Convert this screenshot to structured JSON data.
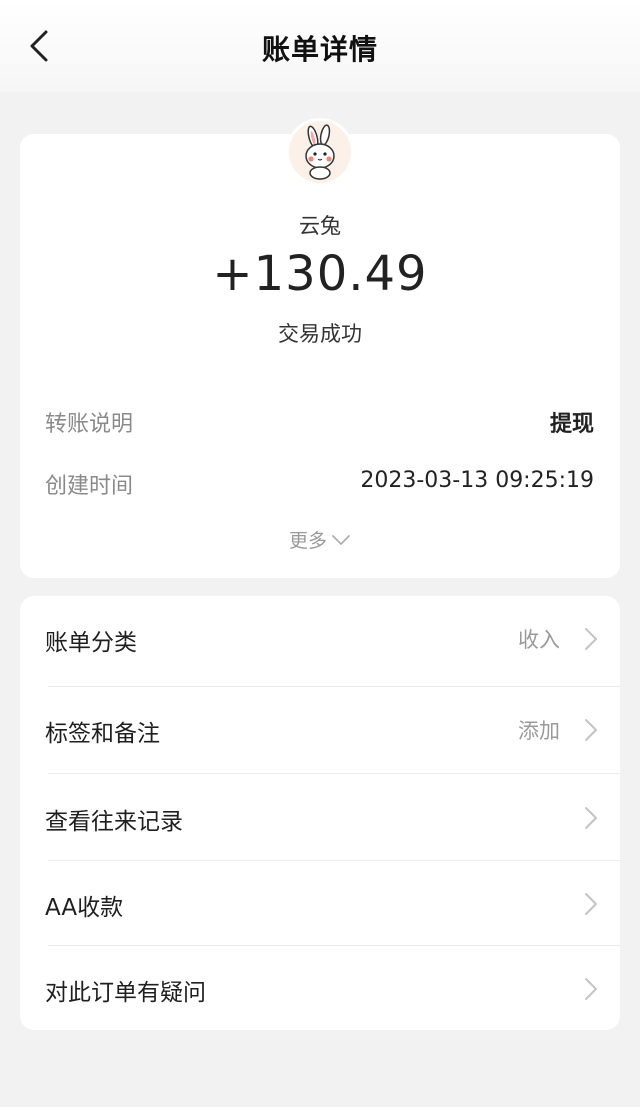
{
  "header": {
    "title": "账单详情"
  },
  "summary": {
    "payee": "云兔",
    "amount": "+130.49",
    "status": "交易成功"
  },
  "details": [
    {
      "label": "转账说明",
      "value": "提现"
    },
    {
      "label": "创建时间",
      "value": "2023-03-13 09:25:19"
    }
  ],
  "more_label": "更多",
  "menu": [
    {
      "label": "账单分类",
      "value": "收入"
    },
    {
      "label": "标签和备注",
      "value": "添加"
    },
    {
      "label": "查看往来记录",
      "value": ""
    },
    {
      "label": "AA收款",
      "value": ""
    },
    {
      "label": "对此订单有疑问",
      "value": ""
    }
  ]
}
